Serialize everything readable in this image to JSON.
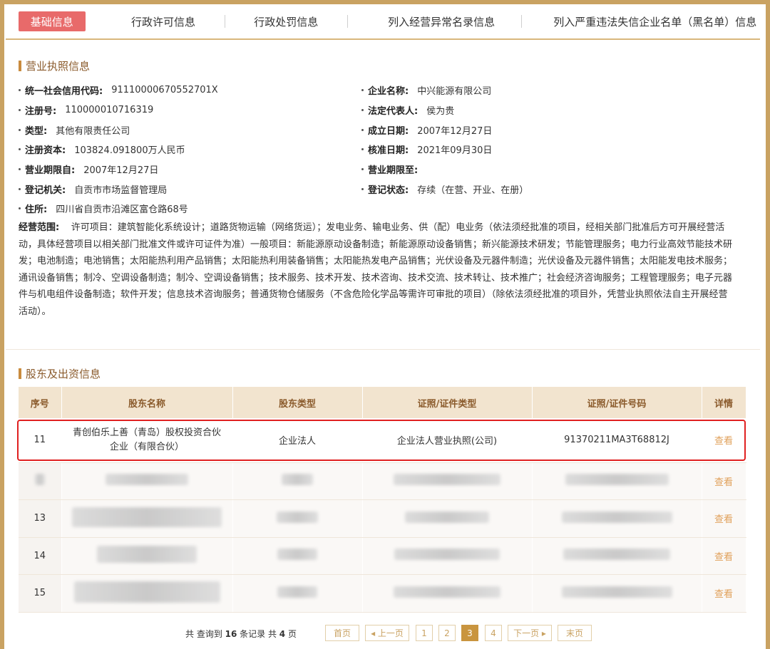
{
  "tabs": [
    {
      "label": "基础信息",
      "active": true
    },
    {
      "label": "行政许可信息",
      "active": false
    },
    {
      "label": "行政处罚信息",
      "active": false
    },
    {
      "label": "列入经营异常名录信息",
      "active": false
    },
    {
      "label": "列入严重违法失信企业名单（黑名单）信息",
      "active": false
    }
  ],
  "license": {
    "title": "营业执照信息",
    "credit_code": {
      "label": "统一社会信用代码:",
      "value": "91110000670552701X"
    },
    "company_name": {
      "label": "企业名称:",
      "value": "中兴能源有限公司"
    },
    "reg_no": {
      "label": "注册号:",
      "value": "110000010716319"
    },
    "legal_rep": {
      "label": "法定代表人:",
      "value": "侯为贵"
    },
    "type": {
      "label": "类型:",
      "value": "其他有限责任公司"
    },
    "founded": {
      "label": "成立日期:",
      "value": "2007年12月27日"
    },
    "capital": {
      "label": "注册资本:",
      "value": "103824.091800万人民币"
    },
    "approved": {
      "label": "核准日期:",
      "value": "2021年09月30日"
    },
    "term_from": {
      "label": "营业期限自:",
      "value": "2007年12月27日"
    },
    "term_to": {
      "label": "营业期限至:",
      "value": ""
    },
    "authority": {
      "label": "登记机关:",
      "value": "自贡市市场监督管理局"
    },
    "status": {
      "label": "登记状态:",
      "value": "存续（在营、开业、在册）"
    },
    "address": {
      "label": "住所:",
      "value": "四川省自贡市沿滩区富仓路68号"
    },
    "scope": {
      "label": "经营范围:",
      "value": "许可项目：建筑智能化系统设计；道路货物运输（网络货运）；发电业务、输电业务、供（配）电业务（依法须经批准的项目，经相关部门批准后方可开展经营活动，具体经营项目以相关部门批准文件或许可证件为准）一般项目：新能源原动设备制造；新能源原动设备销售；新兴能源技术研发；节能管理服务；电力行业高效节能技术研发；电池制造；电池销售；太阳能热利用产品销售；太阳能热利用装备销售；太阳能热发电产品销售；光伏设备及元器件制造；光伏设备及元器件销售；太阳能发电技术服务；通讯设备销售；制冷、空调设备制造；制冷、空调设备销售；技术服务、技术开发、技术咨询、技术交流、技术转让、技术推广；社会经济咨询服务；工程管理服务；电子元器件与机电组件设备制造；软件开发；信息技术咨询服务；普通货物仓储服务（不含危险化学品等需许可审批的项目）（除依法须经批准的项目外，凭营业执照依法自主开展经营活动）。"
    }
  },
  "shareholders": {
    "title": "股东及出资信息",
    "headers": [
      "序号",
      "股东名称",
      "股东类型",
      "证照/证件类型",
      "证照/证件号码",
      "详情"
    ],
    "rows": [
      {
        "seq": "11",
        "name_line1": "青创伯乐上善（青岛）股权投资合伙",
        "name_line2": "企业（有限合伙）",
        "type": "企业法人",
        "id_type": "企业法人营业执照(公司)",
        "id_no": "91370211MA3T68812J",
        "detail": "查看"
      },
      {
        "seq": "",
        "detail": "查看"
      },
      {
        "seq": "13",
        "detail": "查看"
      },
      {
        "seq": "14",
        "detail": "查看"
      },
      {
        "seq": "15",
        "detail": "查看"
      }
    ]
  },
  "pager": {
    "info_prefix": "共 查询到 ",
    "total": "16",
    "info_mid": " 条记录 共 ",
    "pages": "4",
    "info_suffix": " 页",
    "first": "首页",
    "prev": "◂ 上一页",
    "page_numbers": [
      "1",
      "2",
      "3",
      "4"
    ],
    "current": "3",
    "next": "下一页 ▸",
    "last": "末页"
  }
}
